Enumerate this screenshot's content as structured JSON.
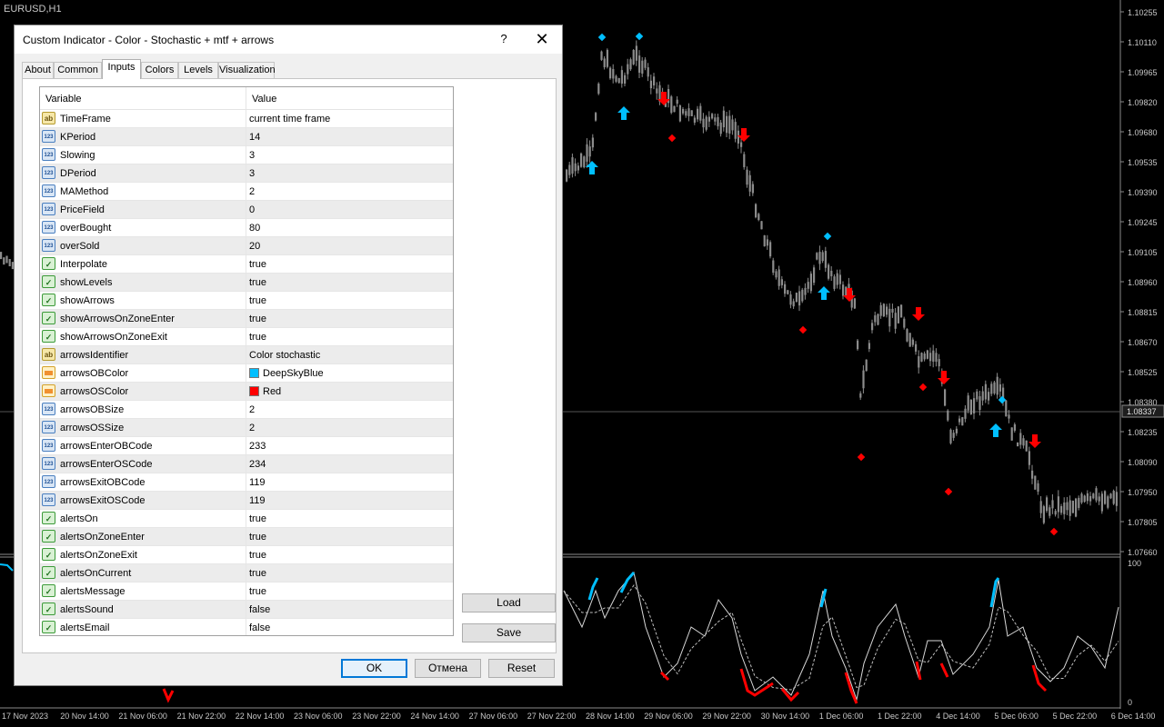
{
  "chart": {
    "symbol": "EURUSD,H1",
    "price_labels": [
      "1.10255",
      "1.10110",
      "1.09965",
      "1.09820",
      "1.09680",
      "1.09535",
      "1.09390",
      "1.09245",
      "1.09105",
      "1.08960",
      "1.08815",
      "1.08670",
      "1.08525",
      "1.08380",
      "1.08235",
      "1.08090",
      "1.07950",
      "1.07805",
      "1.07660"
    ],
    "current_price": "1.08337",
    "osc_labels": [
      "100",
      "0"
    ],
    "time_labels": [
      "17 Nov 2023",
      "20 Nov 14:00",
      "21 Nov 06:00",
      "21 Nov 22:00",
      "22 Nov 14:00",
      "23 Nov 06:00",
      "23 Nov 22:00",
      "24 Nov 14:00",
      "27 Nov 06:00",
      "27 Nov 22:00",
      "28 Nov 14:00",
      "29 Nov 06:00",
      "29 Nov 22:00",
      "30 Nov 14:00",
      "1 Dec 06:00",
      "1 Dec 22:00",
      "4 Dec 14:00",
      "5 Dec 06:00",
      "5 Dec 22:00",
      "6 Dec 14:00"
    ],
    "colors": {
      "up_arrow": "#00bfff",
      "down_arrow": "#ff0000",
      "candle": "#8c8c8c",
      "background": "#000000"
    }
  },
  "dialog": {
    "title": "Custom Indicator - Color - Stochastic + mtf + arrows",
    "help_icon": "?",
    "close_icon": "✕",
    "tabs": [
      "About",
      "Common",
      "Inputs",
      "Colors",
      "Levels",
      "Visualization"
    ],
    "active_tab": "Inputs",
    "columns": {
      "variable": "Variable",
      "value": "Value"
    },
    "params": [
      {
        "name": "TimeFrame",
        "value": "current time frame",
        "type": "str"
      },
      {
        "name": "KPeriod",
        "value": "14",
        "type": "num"
      },
      {
        "name": "Slowing",
        "value": "3",
        "type": "num"
      },
      {
        "name": "DPeriod",
        "value": "3",
        "type": "num"
      },
      {
        "name": "MAMethod",
        "value": "2",
        "type": "num"
      },
      {
        "name": "PriceField",
        "value": "0",
        "type": "num"
      },
      {
        "name": "overBought",
        "value": "80",
        "type": "num"
      },
      {
        "name": "overSold",
        "value": "20",
        "type": "num"
      },
      {
        "name": "Interpolate",
        "value": "true",
        "type": "bool"
      },
      {
        "name": "showLevels",
        "value": "true",
        "type": "bool"
      },
      {
        "name": "showArrows",
        "value": "true",
        "type": "bool"
      },
      {
        "name": "showArrowsOnZoneEnter",
        "value": "true",
        "type": "bool"
      },
      {
        "name": "showArrowsOnZoneExit",
        "value": "true",
        "type": "bool"
      },
      {
        "name": "arrowsIdentifier",
        "value": "Color stochastic",
        "type": "str"
      },
      {
        "name": "arrowsOBColor",
        "value": "DeepSkyBlue",
        "type": "clr",
        "swatch": "#00bfff"
      },
      {
        "name": "arrowsOSColor",
        "value": "Red",
        "type": "clr",
        "swatch": "#ff0000"
      },
      {
        "name": "arrowsOBSize",
        "value": "2",
        "type": "num"
      },
      {
        "name": "arrowsOSSize",
        "value": "2",
        "type": "num"
      },
      {
        "name": "arrowsEnterOBCode",
        "value": "233",
        "type": "num"
      },
      {
        "name": "arrowsEnterOSCode",
        "value": "234",
        "type": "num"
      },
      {
        "name": "arrowsExitOBCode",
        "value": "119",
        "type": "num"
      },
      {
        "name": "arrowsExitOSCode",
        "value": "119",
        "type": "num"
      },
      {
        "name": "alertsOn",
        "value": "true",
        "type": "bool"
      },
      {
        "name": "alertsOnZoneEnter",
        "value": "true",
        "type": "bool"
      },
      {
        "name": "alertsOnZoneExit",
        "value": "true",
        "type": "bool"
      },
      {
        "name": "alertsOnCurrent",
        "value": "true",
        "type": "bool"
      },
      {
        "name": "alertsMessage",
        "value": "true",
        "type": "bool"
      },
      {
        "name": "alertsSound",
        "value": "false",
        "type": "bool"
      },
      {
        "name": "alertsEmail",
        "value": "false",
        "type": "bool"
      }
    ],
    "buttons": {
      "load": "Load",
      "save": "Save",
      "ok": "OK",
      "cancel": "Отмена",
      "reset": "Reset"
    }
  }
}
